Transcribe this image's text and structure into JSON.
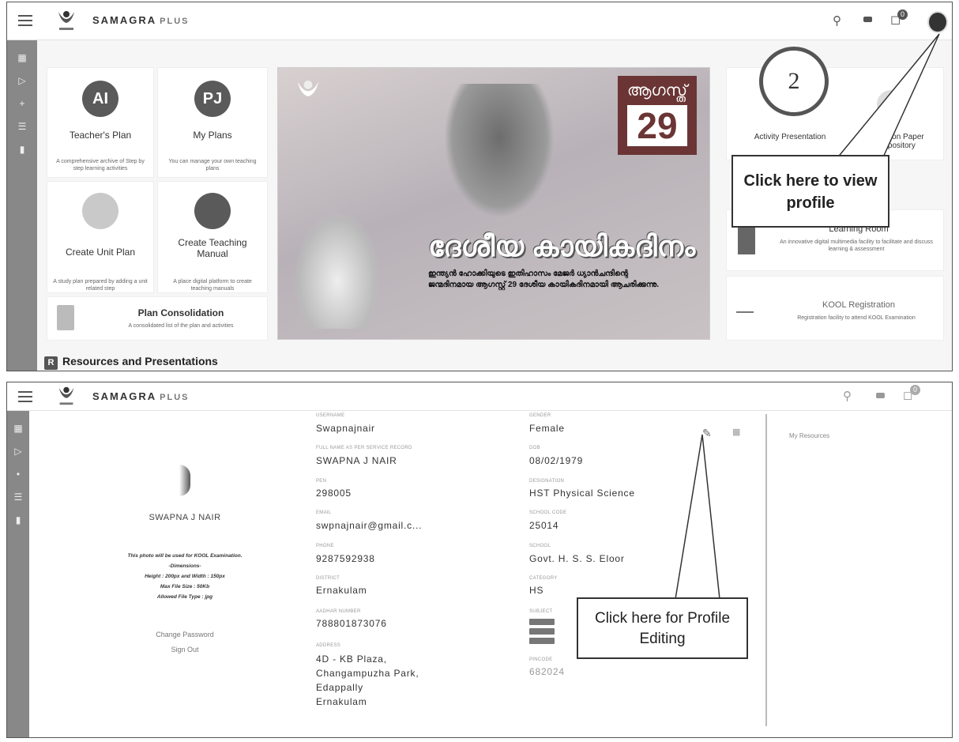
{
  "top": {
    "brand": "SAMAGRA",
    "brand_suffix": "PLUS",
    "notification_count": "0",
    "cards": [
      {
        "icon": "AI",
        "title": "Teacher's Plan",
        "desc": "A comprehensive archive of Step by step learning activities"
      },
      {
        "icon": "PJ",
        "title": "My Plans",
        "desc": "You can manage your own teaching plans"
      },
      {
        "icon": "",
        "title": "Create Unit Plan",
        "desc": "A study plan prepared by adding a unit related step"
      },
      {
        "icon": "",
        "title": "Create Teaching Manual",
        "desc": "A place digital platform to create teaching manuals"
      }
    ],
    "plan_consolidation": {
      "title": "Plan Consolidation",
      "desc": "A consolidated list of the plan and activities"
    },
    "banner": {
      "month": "ആഗസ്ത്",
      "day": "29",
      "title": "ദേശീയ കായികദിനം",
      "text": "ഇന്ത്യൻ ഹോക്കിയുടെ ഇതിഹാസം മേജർ ധ്യാൻചന്ദിന്റെ ജന്മദിനമായ ആഗസ്റ്റ് 29 ദേശീയ കായികദിനമായി ആചരിക്കുന്നു."
    },
    "right_cards": [
      {
        "title": "Activity Presentation"
      },
      {
        "title": "Question Paper Repository"
      },
      {
        "title": "Learning Room",
        "desc": "An innovative digital multimedia facility to facilitate and discuss learning & assessment"
      },
      {
        "title": "KOOL Registration",
        "desc": "Registration facility to attend KOOL Examination"
      }
    ],
    "step_number": "2",
    "callout": "Click here to view profile",
    "resources_icon": "R",
    "resources_label": "Resources and Presentations"
  },
  "bottom": {
    "brand": "SAMAGRA",
    "brand_suffix": "PLUS",
    "notification_count": "0",
    "profile_name": "SWAPNA J NAIR",
    "photo_note": [
      "This photo will be used for KOOL Examination.",
      "-Dimensions-",
      "Height : 200px and Width : 150px",
      "Max File Size : 50Kb",
      "Allowed File Type : jpg"
    ],
    "change_password": "Change Password",
    "sign_out": "Sign Out",
    "fields_left": [
      {
        "label": "Username",
        "value": "Swapnajnair"
      },
      {
        "label": "Full Name as per Service Record",
        "value": "SWAPNA J NAIR"
      },
      {
        "label": "PEN",
        "value": "298005"
      },
      {
        "label": "Email",
        "value": "swpnajnair@gmail.c..."
      },
      {
        "label": "Phone",
        "value": "9287592938"
      },
      {
        "label": "District",
        "value": "Ernakulam"
      },
      {
        "label": "Aadhar Number",
        "value": "788801873076"
      },
      {
        "label": "Address",
        "value": "4D - KB Plaza,\nChangampuzha Park,\nEdappally\nErnakulam"
      }
    ],
    "fields_right": [
      {
        "label": "Gender",
        "value": "Female"
      },
      {
        "label": "DOB",
        "value": "08/02/1979"
      },
      {
        "label": "Designation",
        "value": "HST Physical Science"
      },
      {
        "label": "School Code",
        "value": "25014"
      },
      {
        "label": "School",
        "value": "Govt. H. S. S. Eloor"
      },
      {
        "label": "Category",
        "value": "HS"
      },
      {
        "label": "Subject",
        "value": ""
      },
      {
        "label": "Pincode",
        "value": "682024"
      }
    ],
    "my_resources": "My Resources",
    "callout": "Click here for Profile Editing"
  }
}
